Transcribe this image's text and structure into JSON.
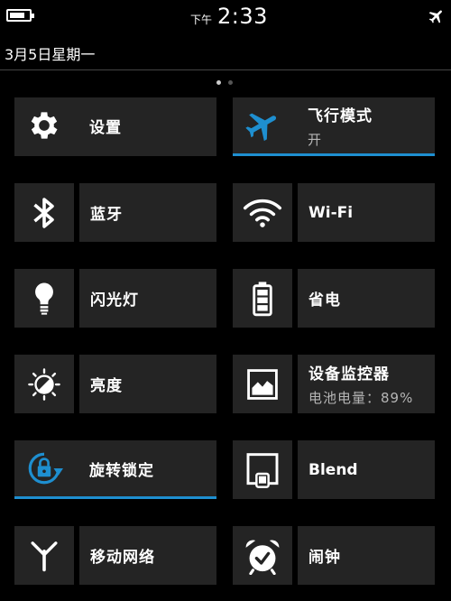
{
  "status_bar": {
    "ampm": "下午",
    "time": "2:33",
    "battery_level": 0.8,
    "battery_icon": "battery-icon",
    "airplane_icon": "airplane-icon"
  },
  "date": "3月5日星期一",
  "pages": {
    "count": 2,
    "current": 1
  },
  "accent_color": "#1e8fd0",
  "tiles": [
    {
      "id": "settings",
      "label": "设置",
      "icon": "gear-icon"
    },
    {
      "id": "airplane",
      "label": "飞行模式",
      "sub": "开",
      "icon": "airplane-icon",
      "active": true
    },
    {
      "id": "bluetooth",
      "label": "蓝牙",
      "icon": "bluetooth-icon"
    },
    {
      "id": "wifi",
      "label": "Wi-Fi",
      "icon": "wifi-icon"
    },
    {
      "id": "flashlight",
      "label": "闪光灯",
      "icon": "lightbulb-icon"
    },
    {
      "id": "battery-saver",
      "label": "省电",
      "icon": "battery-saver-icon"
    },
    {
      "id": "brightness",
      "label": "亮度",
      "icon": "brightness-icon"
    },
    {
      "id": "device-monitor",
      "label": "设备监控器",
      "sub": "电池电量：89%",
      "icon": "picture-icon"
    },
    {
      "id": "rotation-lock",
      "label": "旋转锁定",
      "icon": "rotation-lock-icon",
      "active": true
    },
    {
      "id": "blend",
      "label": "Blend",
      "icon": "blend-icon"
    },
    {
      "id": "mobile-network",
      "label": "移动网络",
      "icon": "antenna-icon"
    },
    {
      "id": "alarm",
      "label": "闹钟",
      "icon": "alarm-clock-icon"
    }
  ]
}
